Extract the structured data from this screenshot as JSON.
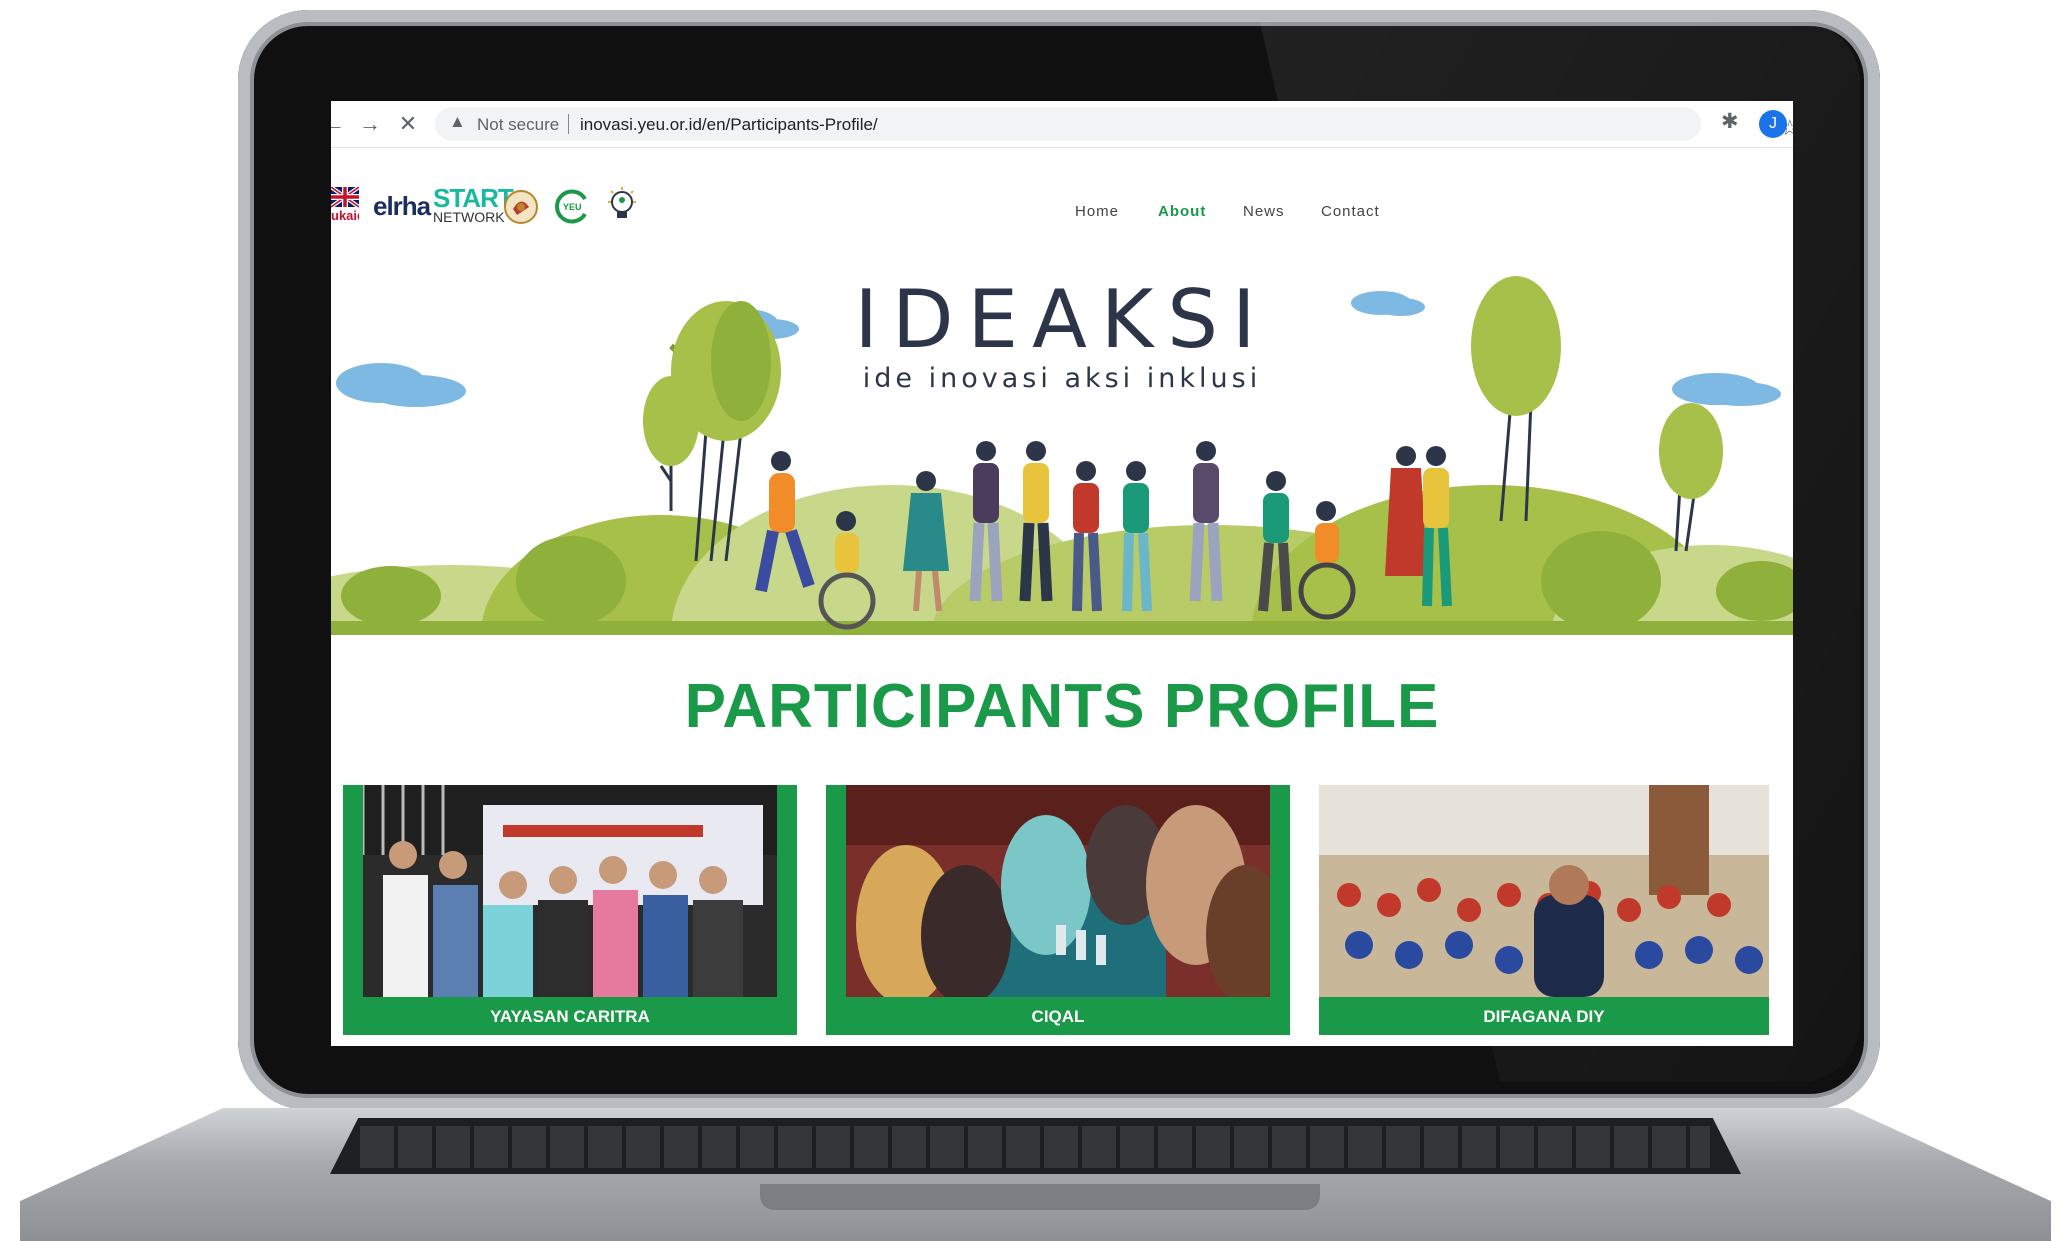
{
  "browser": {
    "security_label": "Not secure",
    "url": "inovasi.yeu.or.id/en/Participants-Profile/",
    "profile_initial": "J",
    "icons": [
      "back-arrow-icon",
      "forward-arrow-icon",
      "stop-icon",
      "warning-icon",
      "star-icon",
      "extensions-icon"
    ]
  },
  "header": {
    "logos": {
      "ukaid": "ukaid",
      "elrha": "elrha",
      "start_line1": "START",
      "start_line2": "NETWORK",
      "yeu": "YEU"
    },
    "nav": [
      {
        "label": "Home"
      },
      {
        "label": "About",
        "active": true
      },
      {
        "label": "News"
      },
      {
        "label": "Contact"
      }
    ]
  },
  "hero": {
    "brand": "IDEAKSI",
    "tagline": "ide inovasi aksi inklusi"
  },
  "main": {
    "title": "PARTICIPANTS PROFILE",
    "cards": [
      {
        "label": "YAYASAN CARITRA"
      },
      {
        "label": "CIQAL"
      },
      {
        "label": "DIFAGANA DIY"
      }
    ]
  },
  "colors": {
    "accent_green": "#1a9a48",
    "brand_dark": "#2d3648",
    "hill_green": "#a6c04a",
    "sky_cloud": "#7db9e3",
    "laptop_bezel": "#101010"
  }
}
